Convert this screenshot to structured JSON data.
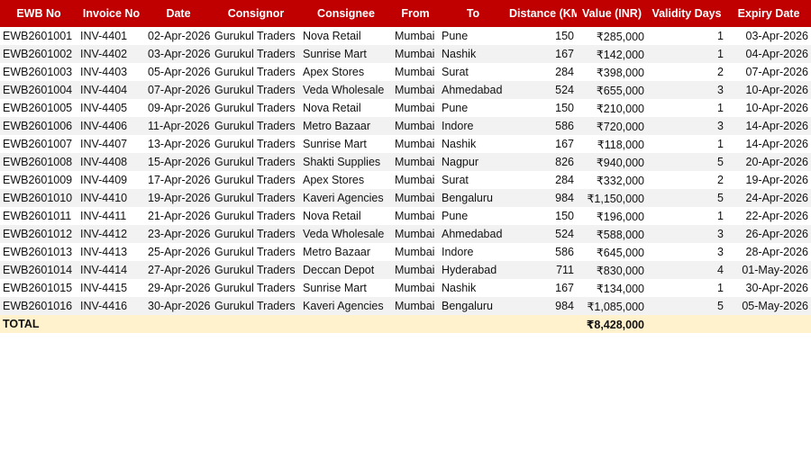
{
  "table": {
    "headers": [
      "EWB No",
      "Invoice No",
      "Date",
      "Consignor",
      "Consignee",
      "From",
      "To",
      "Distance (KM)",
      "Value (INR)",
      "Validity Days",
      "Expiry Date"
    ],
    "rows": [
      [
        "EWB2601001",
        "INV-4401",
        "02-Apr-2026",
        "Gurukul Traders",
        "Nova Retail",
        "Mumbai",
        "Pune",
        "150",
        "₹285,000",
        "1",
        "03-Apr-2026"
      ],
      [
        "EWB2601002",
        "INV-4402",
        "03-Apr-2026",
        "Gurukul Traders",
        "Sunrise Mart",
        "Mumbai",
        "Nashik",
        "167",
        "₹142,000",
        "1",
        "04-Apr-2026"
      ],
      [
        "EWB2601003",
        "INV-4403",
        "05-Apr-2026",
        "Gurukul Traders",
        "Apex Stores",
        "Mumbai",
        "Surat",
        "284",
        "₹398,000",
        "2",
        "07-Apr-2026"
      ],
      [
        "EWB2601004",
        "INV-4404",
        "07-Apr-2026",
        "Gurukul Traders",
        "Veda Wholesale",
        "Mumbai",
        "Ahmedabad",
        "524",
        "₹655,000",
        "3",
        "10-Apr-2026"
      ],
      [
        "EWB2601005",
        "INV-4405",
        "09-Apr-2026",
        "Gurukul Traders",
        "Nova Retail",
        "Mumbai",
        "Pune",
        "150",
        "₹210,000",
        "1",
        "10-Apr-2026"
      ],
      [
        "EWB2601006",
        "INV-4406",
        "11-Apr-2026",
        "Gurukul Traders",
        "Metro Bazaar",
        "Mumbai",
        "Indore",
        "586",
        "₹720,000",
        "3",
        "14-Apr-2026"
      ],
      [
        "EWB2601007",
        "INV-4407",
        "13-Apr-2026",
        "Gurukul Traders",
        "Sunrise Mart",
        "Mumbai",
        "Nashik",
        "167",
        "₹118,000",
        "1",
        "14-Apr-2026"
      ],
      [
        "EWB2601008",
        "INV-4408",
        "15-Apr-2026",
        "Gurukul Traders",
        "Shakti Supplies",
        "Mumbai",
        "Nagpur",
        "826",
        "₹940,000",
        "5",
        "20-Apr-2026"
      ],
      [
        "EWB2601009",
        "INV-4409",
        "17-Apr-2026",
        "Gurukul Traders",
        "Apex Stores",
        "Mumbai",
        "Surat",
        "284",
        "₹332,000",
        "2",
        "19-Apr-2026"
      ],
      [
        "EWB2601010",
        "INV-4410",
        "19-Apr-2026",
        "Gurukul Traders",
        "Kaveri Agencies",
        "Mumbai",
        "Bengaluru",
        "984",
        "₹1,150,000",
        "5",
        "24-Apr-2026"
      ],
      [
        "EWB2601011",
        "INV-4411",
        "21-Apr-2026",
        "Gurukul Traders",
        "Nova Retail",
        "Mumbai",
        "Pune",
        "150",
        "₹196,000",
        "1",
        "22-Apr-2026"
      ],
      [
        "EWB2601012",
        "INV-4412",
        "23-Apr-2026",
        "Gurukul Traders",
        "Veda Wholesale",
        "Mumbai",
        "Ahmedabad",
        "524",
        "₹588,000",
        "3",
        "26-Apr-2026"
      ],
      [
        "EWB2601013",
        "INV-4413",
        "25-Apr-2026",
        "Gurukul Traders",
        "Metro Bazaar",
        "Mumbai",
        "Indore",
        "586",
        "₹645,000",
        "3",
        "28-Apr-2026"
      ],
      [
        "EWB2601014",
        "INV-4414",
        "27-Apr-2026",
        "Gurukul Traders",
        "Deccan Depot",
        "Mumbai",
        "Hyderabad",
        "711",
        "₹830,000",
        "4",
        "01-May-2026"
      ],
      [
        "EWB2601015",
        "INV-4415",
        "29-Apr-2026",
        "Gurukul Traders",
        "Sunrise Mart",
        "Mumbai",
        "Nashik",
        "167",
        "₹134,000",
        "1",
        "30-Apr-2026"
      ],
      [
        "EWB2601016",
        "INV-4416",
        "30-Apr-2026",
        "Gurukul Traders",
        "Kaveri Agencies",
        "Mumbai",
        "Bengaluru",
        "984",
        "₹1,085,000",
        "5",
        "05-May-2026"
      ]
    ],
    "total": {
      "label": "TOTAL",
      "value": "₹8,428,000"
    }
  },
  "colors": {
    "header_bg": "#c00000",
    "header_text": "#ffffff",
    "alt_row_bg": "#f2f2f2",
    "total_row_bg": "#fff2cc"
  }
}
